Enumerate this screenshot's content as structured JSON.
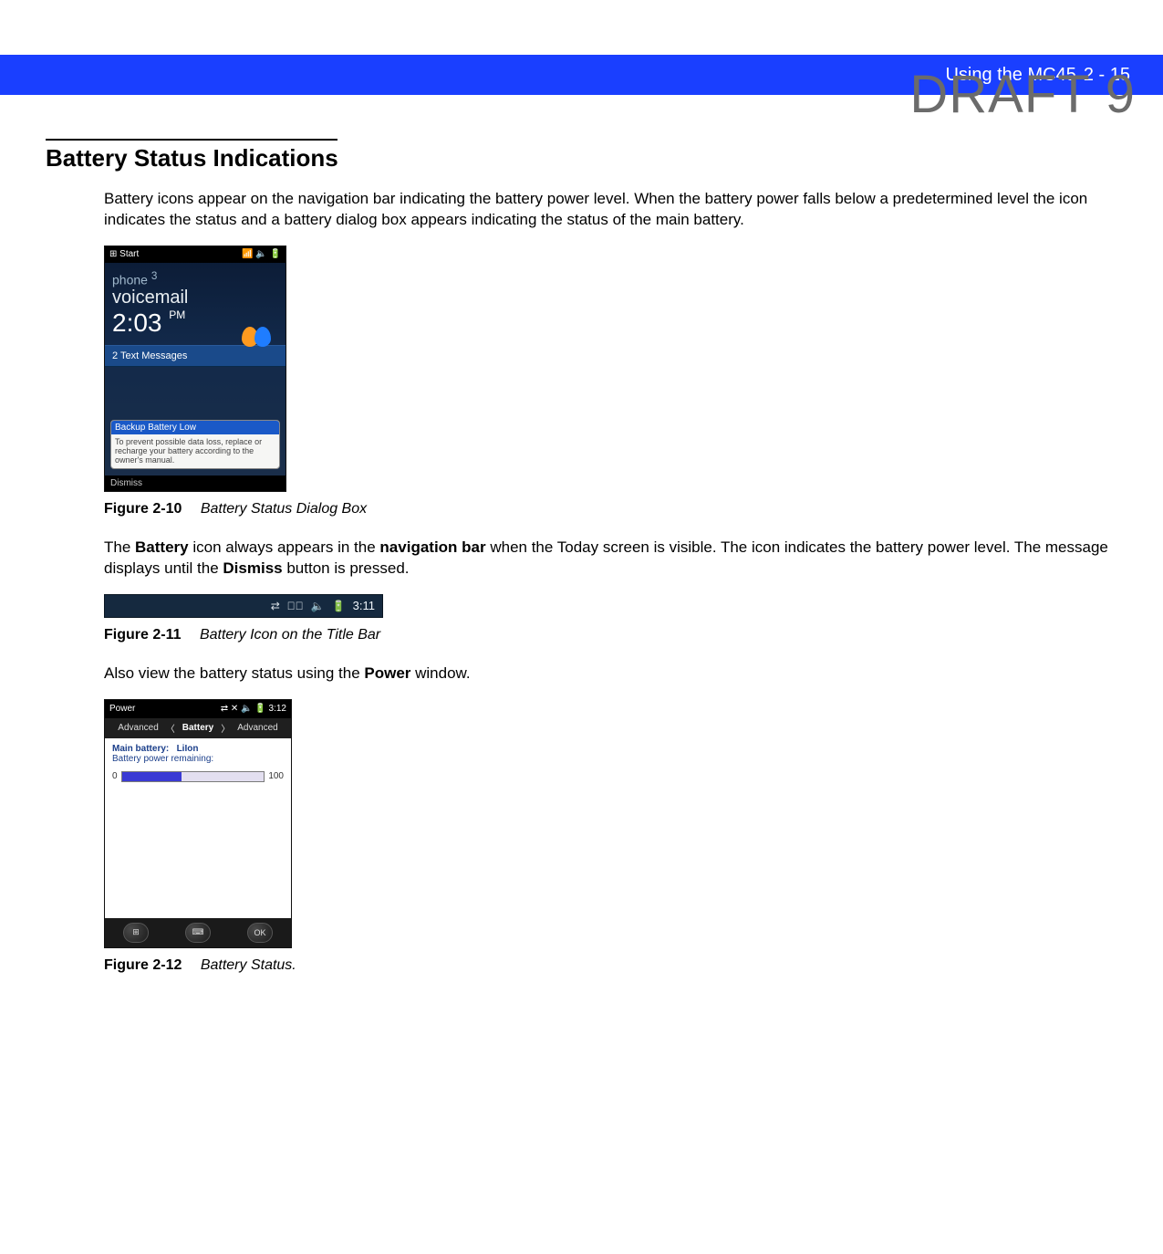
{
  "watermark": "DRAFT 9",
  "header": {
    "chapter_title": "Using the MC45",
    "page_ref": "2 - 15"
  },
  "section": {
    "title": "Battery Status Indications",
    "para1": "Battery icons appear on the navigation bar indicating the battery power level. When the battery power falls below a predetermined level the icon indicates the status and a battery dialog box appears indicating the status of the main battery.",
    "para2_pre": "The ",
    "para2_b1": "Battery",
    "para2_mid1": " icon always appears in the ",
    "para2_b2": "navigation bar",
    "para2_mid2": " when the Today screen is visible. The icon indicates the battery power level. The message displays until the ",
    "para2_b3": "Dismiss",
    "para2_post": " button is pressed.",
    "para3_pre": "Also view the battery status using the ",
    "para3_b1": "Power",
    "para3_post": " window."
  },
  "figures": {
    "f210": {
      "num": "Figure 2-10",
      "title": "Battery Status Dialog Box"
    },
    "f211": {
      "num": "Figure 2-11",
      "title": "Battery Icon on the Title Bar"
    },
    "f212": {
      "num": "Figure 2-12",
      "title": "Battery Status."
    }
  },
  "mock210": {
    "start": "Start",
    "phone": "phone",
    "voicemail": "voicemail",
    "time": "2:03",
    "ampm": "PM",
    "textmsg": "2 Text Messages",
    "popup_title": "Backup Battery Low",
    "popup_body": "To prevent possible data loss, replace or recharge your battery according to the owner's manual.",
    "dismiss": "Dismiss",
    "sup3": "3"
  },
  "mock211": {
    "time": "3:11"
  },
  "mock212": {
    "title": "Power",
    "time": "3:12",
    "tab_left": "Advanced",
    "tab_center": "Battery",
    "tab_right": "Advanced",
    "main_label": "Main battery:",
    "main_type": "LiIon",
    "remain": "Battery power remaining:",
    "min": "0",
    "max": "100",
    "ok": "OK"
  }
}
